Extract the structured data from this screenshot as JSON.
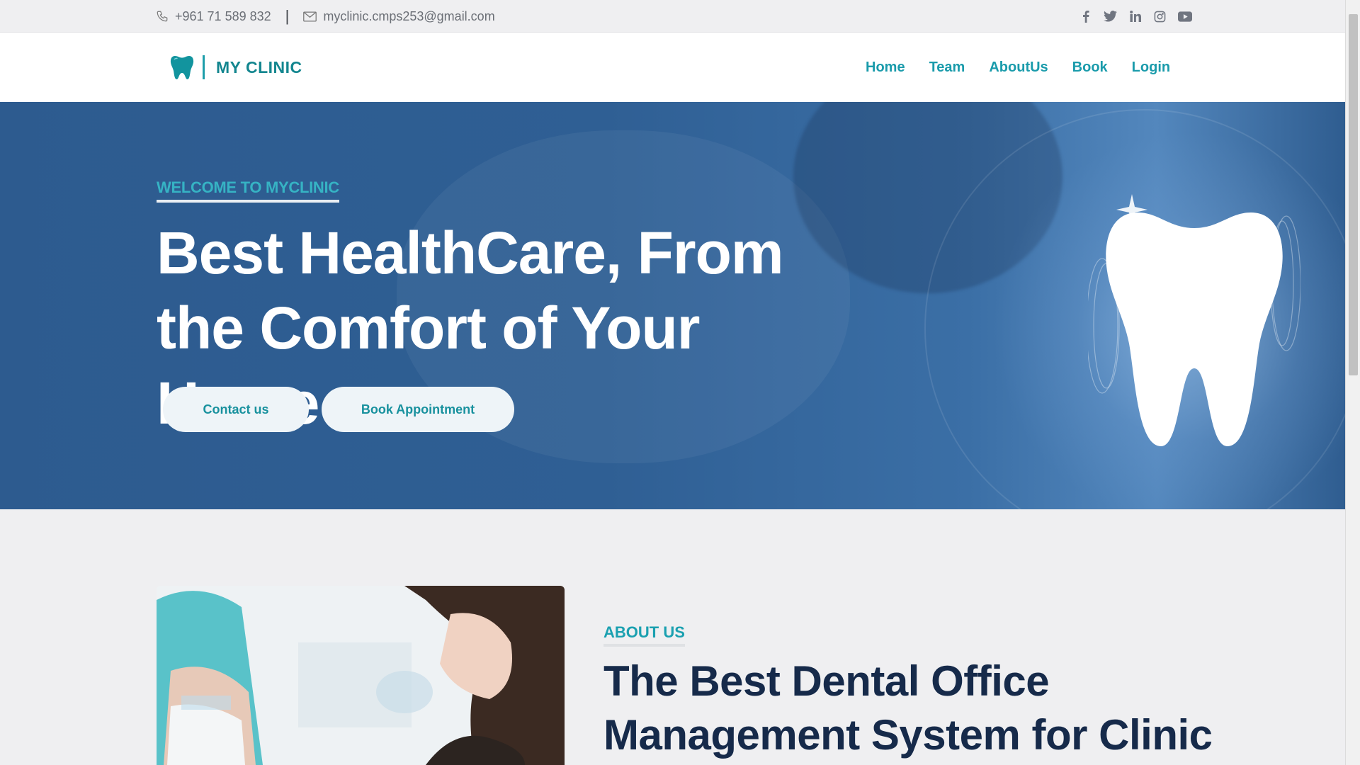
{
  "topbar": {
    "phone": "+961 71 589 832",
    "separator": "|",
    "email": "myclinic.cmps253@gmail.com",
    "social": [
      "facebook-icon",
      "twitter-icon",
      "linkedin-icon",
      "instagram-icon",
      "youtube-icon"
    ]
  },
  "brand": {
    "name": "MY CLINIC"
  },
  "nav": {
    "items": [
      "Home",
      "Team",
      "AboutUs",
      "Book",
      "Login"
    ]
  },
  "hero": {
    "eyebrow": "WELCOME TO MYCLINIC",
    "title": "Best HealthCare, From the Comfort of Your Home",
    "contact_label": "Contact us",
    "book_label": "Book Appointment"
  },
  "about": {
    "eyebrow": "ABOUT US",
    "title": "The Best Dental Office Management System for Clinic"
  },
  "colors": {
    "accent": "#1a9bab",
    "hero_bg": "#2f5f94",
    "heading_dark": "#162a4a"
  }
}
